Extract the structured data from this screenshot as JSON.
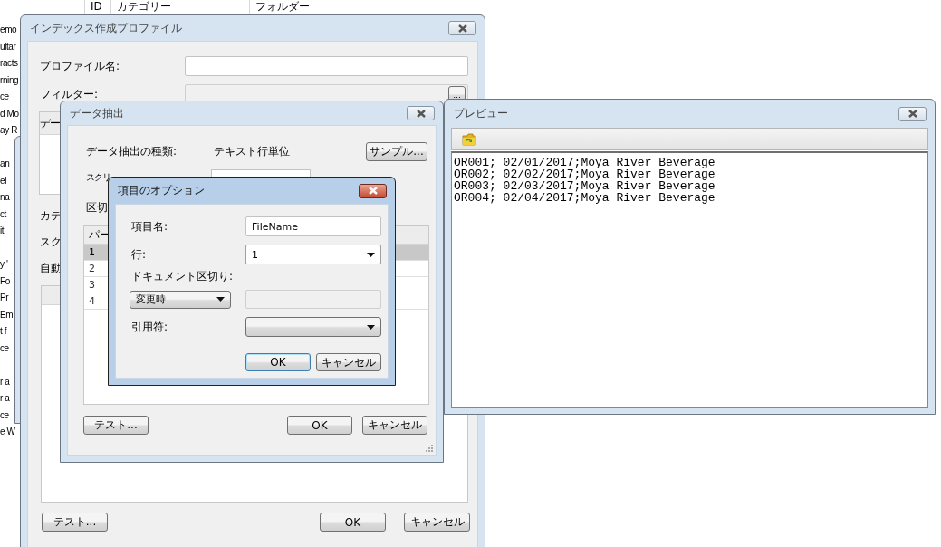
{
  "background": {
    "columns": [
      "ID",
      "カテゴリー",
      "フォルダー"
    ],
    "list_groups": [
      [
        "emo",
        "ultar",
        "racts",
        "rning",
        "ce",
        "d Mo",
        "ay R"
      ],
      [
        "an",
        "el",
        "na",
        "ct",
        "it"
      ],
      [
        "y '",
        "Fo",
        "Pr",
        "Em",
        "t f",
        "ce"
      ],
      [
        "r a",
        "r a",
        "ce",
        "e W"
      ]
    ]
  },
  "profile_window": {
    "title": "インデックス作成プロファイル",
    "active": false,
    "fields": [
      {
        "label": "プロファイル名:",
        "disabled": false
      },
      {
        "label": "フィルター:",
        "disabled": true,
        "browse_button": "..."
      }
    ],
    "data_list_header": "デー",
    "labels": [
      "カテ",
      "スク",
      "自動"
    ],
    "buttons": [
      {
        "label": "テスト..."
      },
      {
        "label": "OK"
      },
      {
        "label": "キャンセル"
      }
    ]
  },
  "extraction_window": {
    "title": "データ抽出",
    "active": false,
    "rows": [
      {
        "kind": "value",
        "label": "データ抽出の種類:",
        "value": "テキスト行単位",
        "button": "サンプル..."
      },
      {
        "kind": "field",
        "label": "スクリ"
      },
      {
        "kind": "label",
        "label": "区切"
      }
    ],
    "table": {
      "header": "パー",
      "rows": [
        {
          "text": "1",
          "selected": true
        },
        {
          "text": "2",
          "selected": false
        },
        {
          "text": "3",
          "selected": false
        },
        {
          "text": "4",
          "selected": false
        }
      ]
    },
    "buttons": [
      {
        "label": "テスト..."
      },
      {
        "label": "OK"
      },
      {
        "label": "キャンセル"
      }
    ]
  },
  "options_window": {
    "title": "項目のオプション",
    "active": true,
    "rows": [
      {
        "kind": "text",
        "label": "項目名:",
        "value": "FileName"
      },
      {
        "kind": "dropdown",
        "label": "行:",
        "value": "1"
      },
      {
        "kind": "heading",
        "label": "ドキュメント区切り:"
      },
      {
        "kind": "split",
        "value": "変更時",
        "field_disabled": true
      },
      {
        "kind": "dropdown",
        "label": "引用符:"
      }
    ],
    "buttons": [
      {
        "label": "OK",
        "focused": true
      },
      {
        "label": "キャンセル",
        "focused": false
      }
    ]
  },
  "preview_window": {
    "title": "プレビュー",
    "active": false,
    "lines": [
      "OR001; 02/01/2017;Moya River Beverage",
      "OR002; 02/02/2017;Moya River Beverage",
      "OR003; 02/03/2017;Moya River Beverage",
      "OR004; 02/04/2017;Moya River Beverage"
    ]
  }
}
